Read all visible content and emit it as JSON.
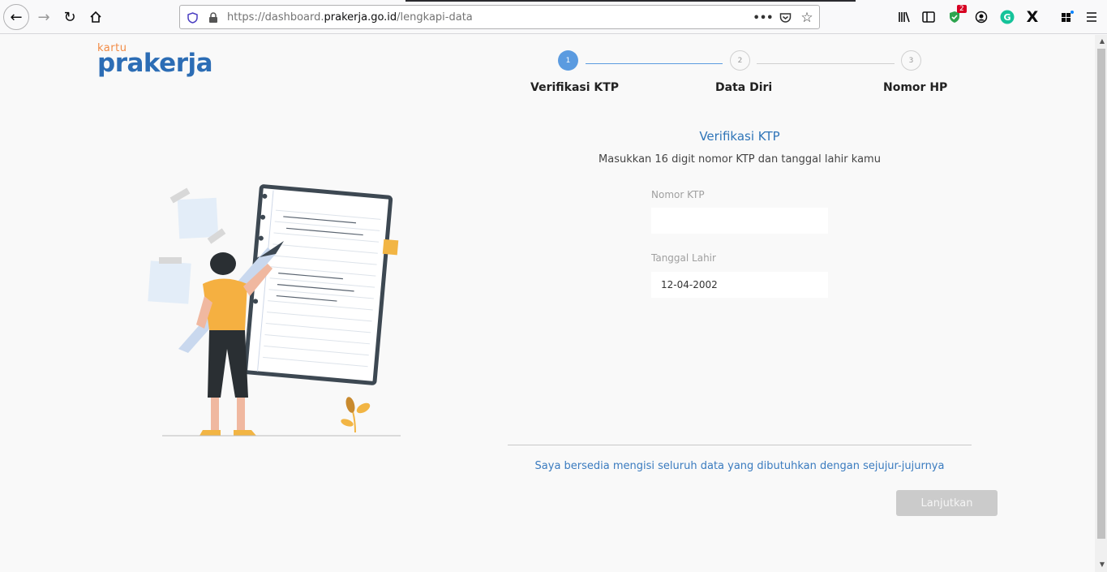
{
  "browser": {
    "url_prefix": "https://dashboard.",
    "url_domain": "prakerja.go.id",
    "url_path": "/lengkapi-data",
    "extension_badge": "2"
  },
  "logo": {
    "small": "kartu",
    "big": "prakerja"
  },
  "stepper": {
    "steps": [
      {
        "number": "1",
        "label": "Verifikasi KTP"
      },
      {
        "number": "2",
        "label": "Data Diri"
      },
      {
        "number": "3",
        "label": "Nomor HP"
      }
    ]
  },
  "form": {
    "title": "Verifikasi KTP",
    "subtitle": "Masukkan 16 digit nomor KTP dan tanggal lahir kamu",
    "ktp_label": "Nomor KTP",
    "ktp_value": "",
    "dob_label": "Tanggal Lahir",
    "dob_value": "12-04-2002"
  },
  "consent_text": "Saya bersedia mengisi seluruh data yang dibutuhkan dengan sejujur-jujurnya",
  "submit_label": "Lanjutkan",
  "colors": {
    "primary": "#2f75b8",
    "accent": "#f28b45",
    "disabled": "#cbcbcb"
  }
}
